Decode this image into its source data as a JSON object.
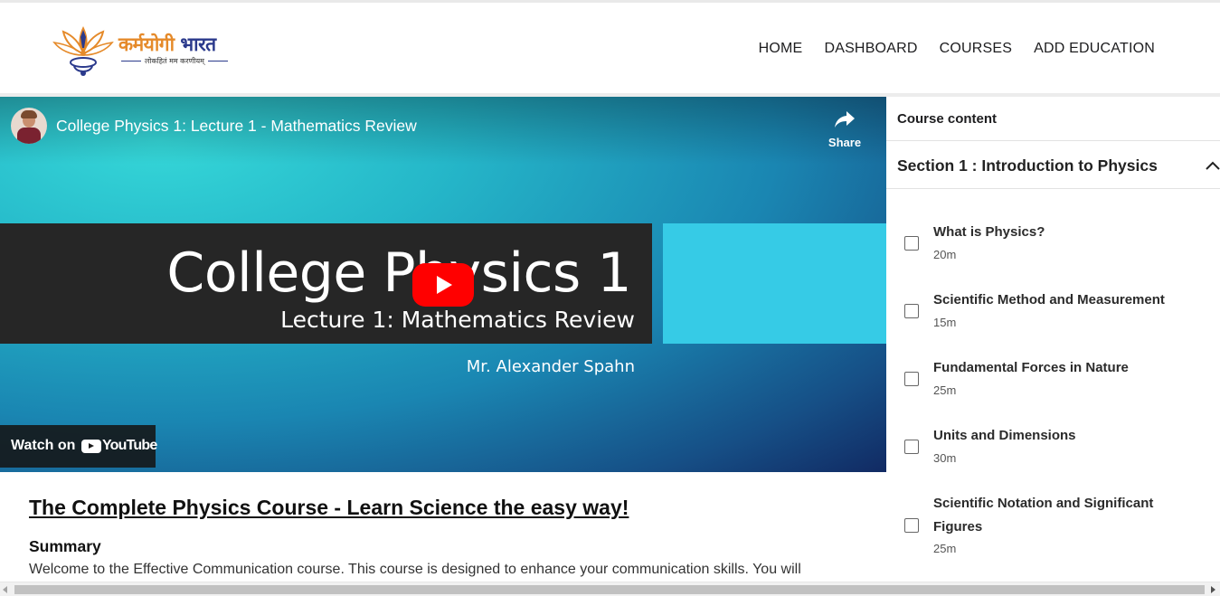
{
  "header": {
    "logo_title_part1": "कर्मयोगी",
    "logo_title_part2": "भारत",
    "logo_tagline": "लोकहितं मम करणीयम्",
    "nav": [
      "HOME",
      "DASHBOARD",
      "COURSES",
      "ADD EDUCATION"
    ]
  },
  "video": {
    "title": "College Physics 1: Lecture 1 - Mathematics Review",
    "share_label": "Share",
    "slide_heading": "College Physics 1",
    "slide_subheading": "Lecture 1: Mathematics Review",
    "slide_author": "Mr. Alexander Spahn",
    "watch_on_label": "Watch on",
    "youtube_wordmark": "YouTube"
  },
  "sidebar": {
    "title": "Course content",
    "section_title": "Section 1 : Introduction to Physics",
    "lessons": [
      {
        "name": "What is Physics?",
        "duration": "20m"
      },
      {
        "name": "Scientific Method and Measurement",
        "duration": "15m"
      },
      {
        "name": "Fundamental Forces in Nature",
        "duration": "25m"
      },
      {
        "name": "Units and Dimensions",
        "duration": "30m"
      },
      {
        "name": "Scientific Notation and Significant Figures",
        "duration": "25m"
      }
    ]
  },
  "course": {
    "title": "The Complete Physics Course - Learn Science the easy way!",
    "summary_heading": "Summary",
    "summary_text": "Welcome to the Effective Communication course. This course is designed to enhance your communication skills. You will"
  },
  "colors": {
    "logo_orange": "#e58a2a",
    "logo_blue": "#2b3a8c",
    "youtube_red": "#ff0000",
    "slide_cyan": "#36cbe6"
  },
  "icons": [
    "lotus-logo-icon",
    "share-arrow-icon",
    "play-icon",
    "youtube-icon",
    "chevron-up-icon",
    "checkbox-icon"
  ]
}
